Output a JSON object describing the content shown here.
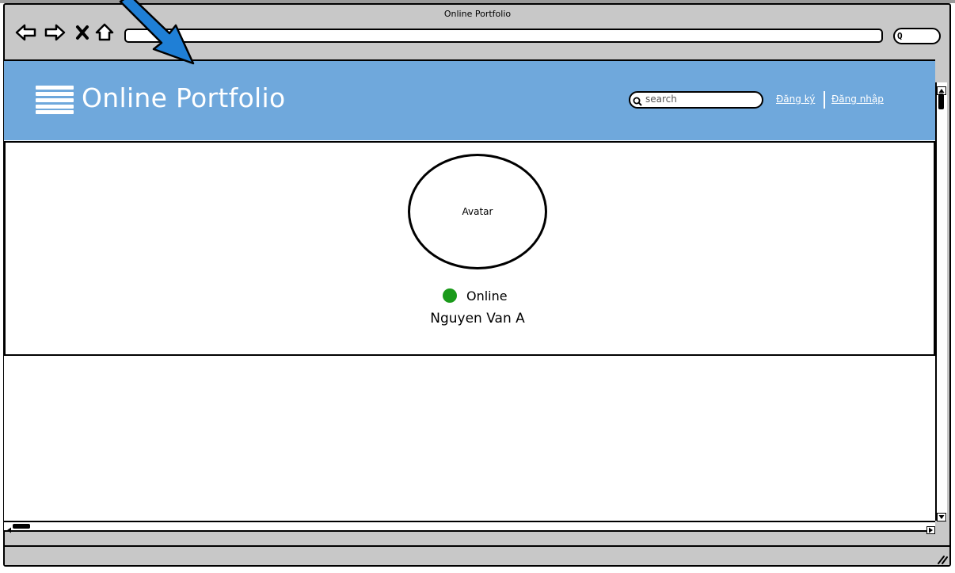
{
  "window": {
    "title": "Online Portfolio",
    "address_value": "",
    "search_go_glyph": "Q"
  },
  "header": {
    "site_title": "Online Portfolio",
    "search_placeholder": "search",
    "register_label": "Đăng ký",
    "login_label": "Đăng nhập",
    "bg_color": "#6fa8dc"
  },
  "profile": {
    "avatar_label": "Avatar",
    "status_text": "Online",
    "status_color": "#1a9a1a",
    "user_name": "Nguyen Van A"
  },
  "icons": [
    "back-icon",
    "forward-icon",
    "close-icon",
    "home-icon",
    "search-icon",
    "menu-icon",
    "resize-grip-icon",
    "arrow-annotation-icon"
  ]
}
